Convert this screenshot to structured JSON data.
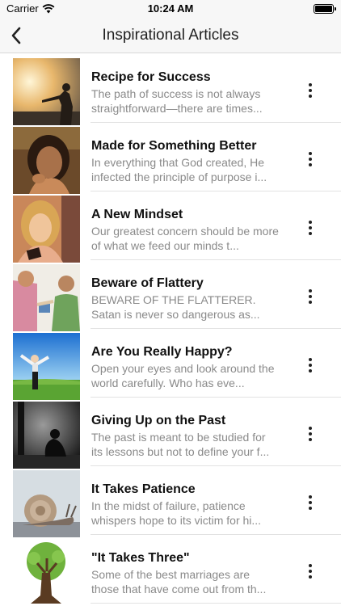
{
  "status_bar": {
    "carrier": "Carrier",
    "time": "10:24 AM"
  },
  "nav": {
    "title": "Inspirational Articles"
  },
  "articles": [
    {
      "title": "Recipe for Success",
      "excerpt": "The path of success is not always straightforward—there are times..."
    },
    {
      "title": "Made for Something Better",
      "excerpt": "In everything that God created, He infected the principle of purpose i..."
    },
    {
      "title": "A New Mindset",
      "excerpt": "Our greatest concern should be more of what we feed our minds t..."
    },
    {
      "title": "Beware of Flattery",
      "excerpt": "BEWARE OF THE FLATTERER. Satan is never so dangerous as..."
    },
    {
      "title": "Are You Really Happy?",
      "excerpt": "Open your eyes and look around the world carefully. Who has eve..."
    },
    {
      "title": "Giving Up on the Past",
      "excerpt": "The past is meant to be studied for its lessons but not to define your f..."
    },
    {
      "title": "It Takes Patience",
      "excerpt": "In the midst of failure, patience whispers hope to its victim for hi..."
    },
    {
      "title": "\"It Takes Three\"",
      "excerpt": "Some of the best marriages are those that have come out from th..."
    }
  ]
}
